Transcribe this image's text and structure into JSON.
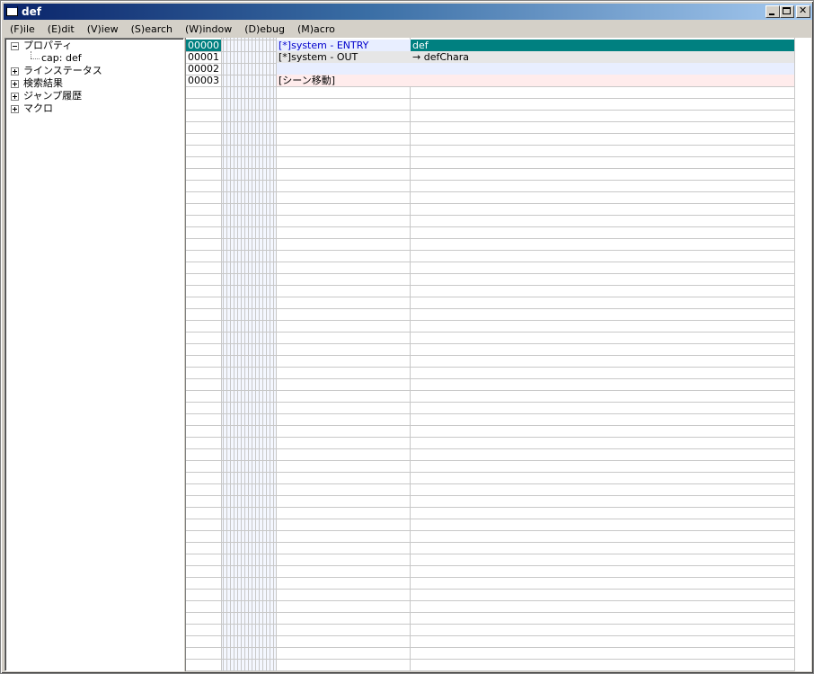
{
  "window": {
    "title": "def"
  },
  "menu": [
    {
      "label": "(F)ile"
    },
    {
      "label": "(E)dit"
    },
    {
      "label": "(V)iew"
    },
    {
      "label": "(S)earch"
    },
    {
      "label": "(W)indow"
    },
    {
      "label": "(D)ebug"
    },
    {
      "label": "(M)acro"
    }
  ],
  "tree": {
    "properties": {
      "label": "プロパティ",
      "expanded": true
    },
    "caption_item": {
      "label": "cap: def"
    },
    "line_status": {
      "label": "ラインステータス",
      "expanded": false
    },
    "search_results": {
      "label": "検索結果",
      "expanded": false
    },
    "jump_history": {
      "label": "ジャンプ履歴",
      "expanded": false
    },
    "macro": {
      "label": "マクロ",
      "expanded": false
    }
  },
  "grid": {
    "rows": [
      {
        "num": "00000",
        "cmd": "[*]system -  ENTRY",
        "val": "def",
        "selected": true
      },
      {
        "num": "00001",
        "cmd": "[*]system -  OUT",
        "val": "→ defChara",
        "selected": false
      },
      {
        "num": "00002",
        "cmd": "",
        "val": "",
        "selected": false
      },
      {
        "num": "00003",
        "cmd": "[シーン移動]",
        "val": "",
        "selected": false
      }
    ]
  },
  "colors": {
    "selected_bg": "#008080",
    "selected_num_bg": "#008080",
    "entry_text": "#0000cc",
    "row1_bg": "#e6e6e6",
    "row2_bg": "#e8eeff",
    "row3_bg": "#ffecec"
  }
}
